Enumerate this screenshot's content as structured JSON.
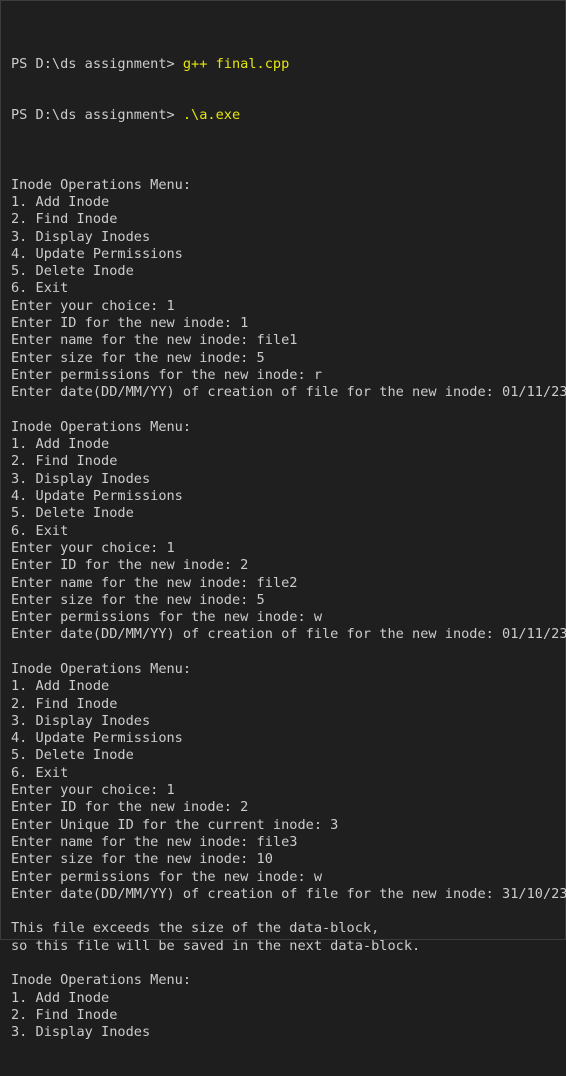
{
  "prompts": [
    {
      "prefix": "PS D:\\ds assignment> ",
      "command": "g++ final.cpp"
    },
    {
      "prefix": "PS D:\\ds assignment> ",
      "command": ".\\a.exe"
    }
  ],
  "output_lines": [
    "",
    "Inode Operations Menu:",
    "1. Add Inode",
    "2. Find Inode",
    "3. Display Inodes",
    "4. Update Permissions",
    "5. Delete Inode",
    "6. Exit",
    "Enter your choice: 1",
    "Enter ID for the new inode: 1",
    "Enter name for the new inode: file1",
    "Enter size for the new inode: 5",
    "Enter permissions for the new inode: r",
    "Enter date(DD/MM/YY) of creation of file for the new inode: 01/11/23",
    "",
    "Inode Operations Menu:",
    "1. Add Inode",
    "2. Find Inode",
    "3. Display Inodes",
    "4. Update Permissions",
    "5. Delete Inode",
    "6. Exit",
    "Enter your choice: 1",
    "Enter ID for the new inode: 2",
    "Enter name for the new inode: file2",
    "Enter size for the new inode: 5",
    "Enter permissions for the new inode: w",
    "Enter date(DD/MM/YY) of creation of file for the new inode: 01/11/23",
    "",
    "Inode Operations Menu:",
    "1. Add Inode",
    "2. Find Inode",
    "3. Display Inodes",
    "4. Update Permissions",
    "5. Delete Inode",
    "6. Exit",
    "Enter your choice: 1",
    "Enter ID for the new inode: 2",
    "Enter Unique ID for the current inode: 3",
    "Enter name for the new inode: file3",
    "Enter size for the new inode: 10",
    "Enter permissions for the new inode: w",
    "Enter date(DD/MM/YY) of creation of file for the new inode: 31/10/23",
    "",
    "This file exceeds the size of the data-block,",
    "so this file will be saved in the next data-block.",
    "",
    "Inode Operations Menu:",
    "1. Add Inode",
    "2. Find Inode",
    "3. Display Inodes"
  ],
  "colors": {
    "background": "#1f1f1f",
    "text": "#cccccc",
    "command": "#e5e510"
  }
}
